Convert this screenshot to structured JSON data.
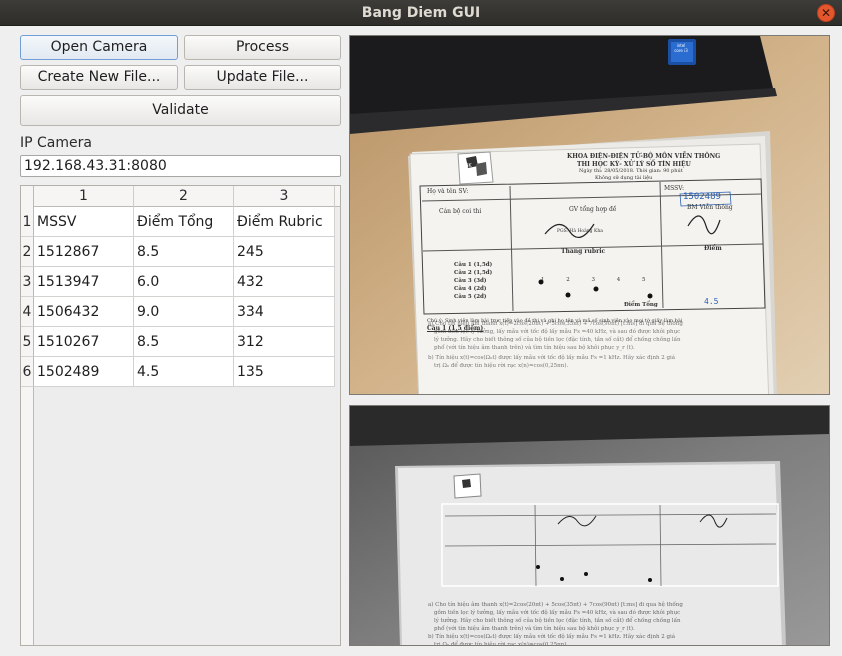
{
  "window": {
    "title": "Bang Diem GUI"
  },
  "buttons": {
    "open_camera": "Open Camera",
    "process": "Process",
    "create_new_file": "Create New File...",
    "update_file": "Update File...",
    "validate": "Validate"
  },
  "ip_camera": {
    "label": "IP Camera",
    "value": "192.168.43.31:8080"
  },
  "table": {
    "column_headers": [
      "1",
      "2",
      "3"
    ],
    "row_headers": [
      "1",
      "2",
      "3",
      "4",
      "5",
      "6"
    ],
    "rows": [
      [
        "MSSV",
        "Điểm Tổng",
        "Điểm Rubric"
      ],
      [
        "1512867",
        "8.5",
        "245"
      ],
      [
        "1513947",
        "6.0",
        "432"
      ],
      [
        "1506432",
        "9.0",
        "334"
      ],
      [
        "1510267",
        "8.5",
        "312"
      ],
      [
        "1502489",
        "4.5",
        "135"
      ]
    ]
  },
  "camera_view": {
    "laptop_badge": "intel core i3",
    "doc_header_line1": "KHOA ĐIỆN-ĐIỆN TỬ-BỘ MÔN VIỄN THÔNG",
    "doc_header_line2": "THI HỌC KỲ- XỬ LÝ SỐ TÍN HIỆU",
    "doc_header_line3": "Ngày thi: 28/05/2018. Thời gian: 90 phút",
    "doc_header_line4": "Không sử dụng tài liệu",
    "logo_text": "BK",
    "name_label": "Họ và tên SV:",
    "mssv_label": "MSSV:",
    "mssv_value": "1502489",
    "examiner_label": "Cán bộ coi thi",
    "teacher_label": "GV tổng hợp đề",
    "teacher_name": "PGS. Hà Hoàng Kha",
    "dept_label": "BM Viễn thông",
    "rubric_label": "Thang rubric",
    "score_label": "Điểm",
    "total_label": "Điểm Tổng",
    "total_value": "4.5",
    "questions": [
      "Câu 1 (1,5đ)",
      "Câu 2 (1,5đ)",
      "Câu 3 (3đ)",
      "Câu 4 (2đ)",
      "Câu 5 (2đ)"
    ],
    "rubric_scale": [
      "1",
      "2",
      "3",
      "4",
      "5"
    ],
    "note": "Chú ý: Sinh viên làm bài trực tiếp vào đề thi và ghi họ tên và mã số sinh viên vào mọi tờ giấy làm bài",
    "q1_title": "Câu 1 (1,5 điểm)",
    "q1_a": "a) Cho tín hiệu âm thanh x(t)=2cos(20πt) + 5cos(35πt) + 7cos(90πt) [t:ms] đi qua hệ thống",
    "q1_a2": "gồm tiền lọc lý tưởng, lấy mẫu với tốc độ lấy mẫu Fs =40 kHz, và sau đó được khôi phục",
    "q1_a3": "lý tưởng. Hãy cho biết thông số của bộ tiền lọc (đặc tính, tần số cắt) để chống chồng lấn",
    "q1_a4": "phổ (với tín hiệu âm thanh trên) và tìm tín hiệu sau bộ khôi phục y_r (t).",
    "q1_b": "b) Tín hiệu x(t)=cos(Ω₀t) được lấy mẫu với tốc độ lấy mẫu Fs =1 kHz. Hãy xác định 2 giá",
    "q1_b2": "trị Ω₀ để được tín hiệu rời rạc x(n)=cos(0,25πn)."
  }
}
